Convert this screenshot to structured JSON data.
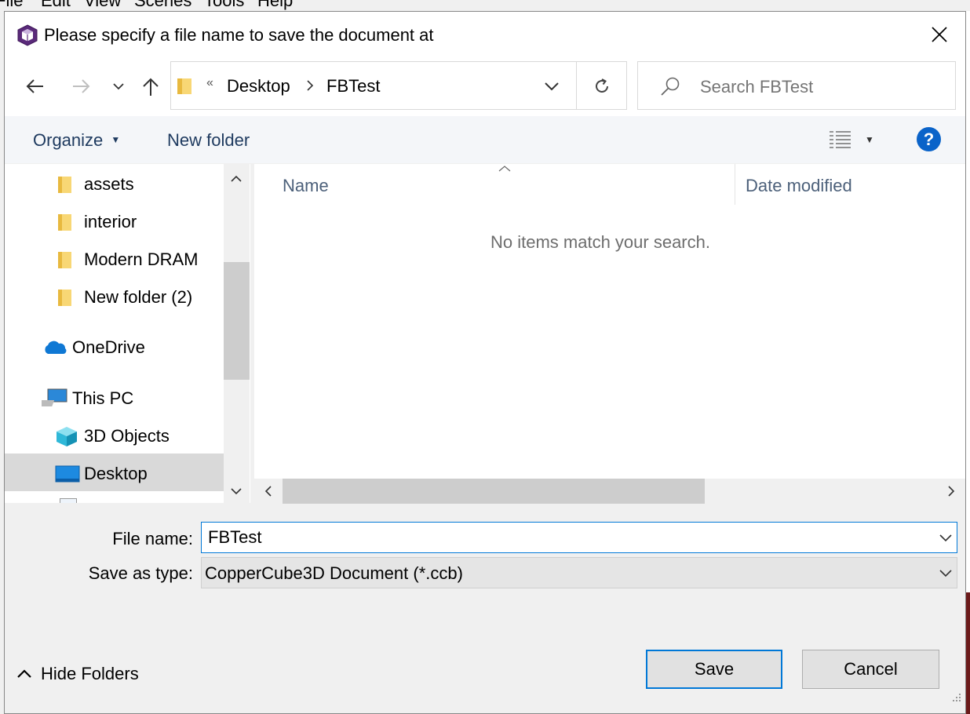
{
  "background_app": {
    "menu": [
      "File",
      "Edit",
      "View",
      "Scenes",
      "Tools",
      "Help"
    ]
  },
  "dialog": {
    "title": "Please specify a file name to save the document at",
    "address": {
      "overflow": "«",
      "crumbs": [
        "Desktop",
        "FBTest"
      ]
    },
    "search_placeholder": "Search FBTest",
    "toolbar": {
      "organize": "Organize",
      "new_folder": "New folder"
    },
    "nav_tree": [
      {
        "label": "assets",
        "icon": "folder-icon"
      },
      {
        "label": "interior",
        "icon": "folder-icon"
      },
      {
        "label": "Modern DRAM",
        "icon": "folder-icon"
      },
      {
        "label": "New folder (2)",
        "icon": "folder-icon"
      },
      {
        "label": "OneDrive",
        "icon": "onedrive-icon"
      },
      {
        "label": "This PC",
        "icon": "this-pc-icon"
      },
      {
        "label": "3D Objects",
        "icon": "3d-objects-icon"
      },
      {
        "label": "Desktop",
        "icon": "desktop-icon",
        "selected": true
      }
    ],
    "columns": {
      "name": "Name",
      "date_modified": "Date modified"
    },
    "empty_message": "No items match your search.",
    "file_name_label": "File name:",
    "file_name_value": "FBTest",
    "save_type_label": "Save as type:",
    "save_type_value": "CopperCube3D Document (*.ccb)",
    "hide_folders": "Hide Folders",
    "save_label": "Save",
    "cancel_label": "Cancel"
  },
  "colors": {
    "accent": "#0078d7",
    "selection": "#d9d9d9",
    "toolbar_text": "#1e3a5f"
  }
}
